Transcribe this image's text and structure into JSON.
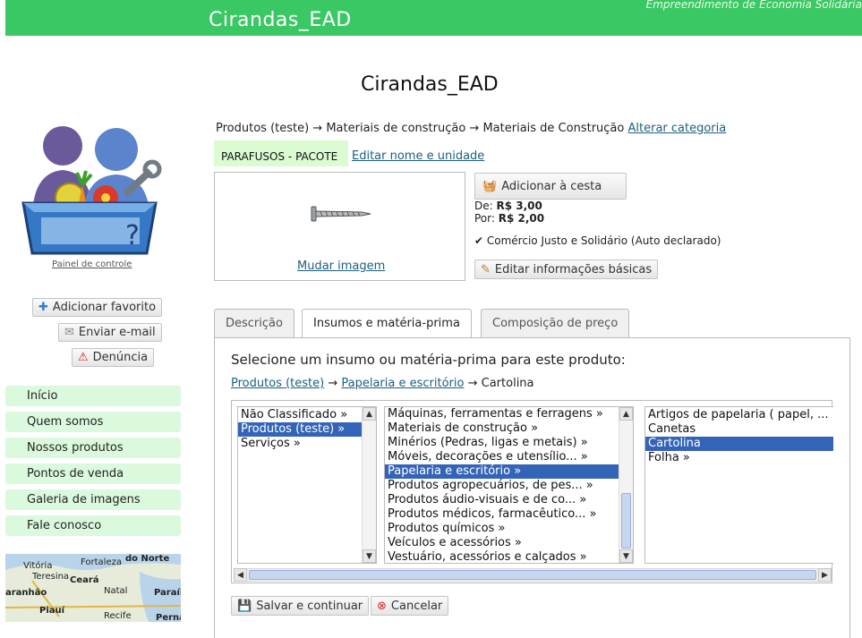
{
  "header": {
    "site_name": "Cirandas_EAD",
    "tagline": "Empreendimento de Economia Solidária"
  },
  "page": {
    "title": "Cirandas_EAD"
  },
  "sidebar": {
    "panel_link": "Painel de controle",
    "actions": {
      "add_favorite": "Adicionar favorito",
      "send_email": "Enviar e-mail",
      "report": "Denúncia"
    },
    "menu": [
      {
        "label": "Início"
      },
      {
        "label": "Quem somos"
      },
      {
        "label": "Nossos produtos"
      },
      {
        "label": "Pontos de venda"
      },
      {
        "label": "Galeria de imagens"
      },
      {
        "label": "Fale conosco"
      }
    ],
    "map": {
      "labels": [
        "Vitória",
        "Fortaleza",
        "do Norte",
        "Teresina",
        "Ceará",
        "aranhão",
        "Natal",
        "Paraíb",
        "Piauí",
        "Recife",
        "Perna"
      ]
    }
  },
  "product": {
    "breadcrumb": {
      "path": "Produtos (teste) → Materiais de construção → Materiais de Construção",
      "change_link": "Alterar categoria"
    },
    "name": "PARAFUSOS - PACOTE",
    "edit_name_link": "Editar nome e unidade",
    "change_image_link": "Mudar imagem",
    "add_to_basket": "Adicionar à cesta",
    "price": {
      "from_label": "De:",
      "from_value": "R$ 3,00",
      "to_label": "Por:",
      "to_value": "R$ 2,00"
    },
    "fair_trade": "Comércio Justo e Solidário (Auto declarado)",
    "edit_basic_info": "Editar informações básicas"
  },
  "tabs": [
    {
      "label": "Descrição"
    },
    {
      "label": "Insumos e matéria-prima"
    },
    {
      "label": "Composição de preço"
    }
  ],
  "inputs_panel": {
    "prompt": "Selecione um insumo ou matéria-prima para este produto:",
    "path": {
      "link1": "Produtos (teste)",
      "sep": "→",
      "link2": "Papelaria e escritório",
      "current": "Cartolina"
    },
    "columns": [
      {
        "items": [
          "Não Classificado »",
          "Produtos (teste) »",
          "Serviços »"
        ],
        "selected": 1
      },
      {
        "items": [
          "Máquinas, ferramentas e ferragens »",
          "Materiais de construção »",
          "Minérios (Pedras, ligas e metais) »",
          "Móveis, decorações e utensílio... »",
          "Papelaria e escritório »",
          "Produtos agropecuários, de pes... »",
          "Produtos áudio-visuais e de co... »",
          "Produtos médicos, farmacêutico... »",
          "Produtos químicos »",
          "Veículos e acessórios »",
          "Vestuário, acessórios e calçados »"
        ],
        "selected": 4
      },
      {
        "items": [
          "Artigos de papelaria ( papel, ...",
          "Canetas",
          "Cartolina",
          "Folha »"
        ],
        "selected": 2
      }
    ],
    "save_button": "Salvar e continuar",
    "cancel_button": "Cancelar"
  }
}
